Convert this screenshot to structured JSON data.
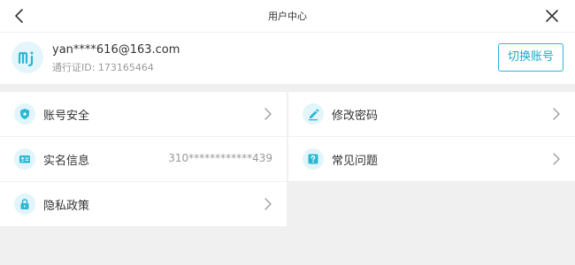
{
  "header": {
    "title": "用户中心",
    "back_icon": "chevron-left-icon",
    "close_icon": "close-icon"
  },
  "profile": {
    "email": "yan****616@163.com",
    "passport_id": "通行证ID: 173165464",
    "switch_label": "切换账号",
    "avatar_icon": "mi-logo-icon"
  },
  "menu": {
    "account_security": {
      "label": "账号安全",
      "icon": "shield-icon"
    },
    "change_password": {
      "label": "修改密码",
      "icon": "pencil-icon"
    },
    "real_name": {
      "label": "实名信息",
      "value": "310************439",
      "icon": "id-card-icon"
    },
    "faq": {
      "label": "常见问题",
      "icon": "question-icon"
    },
    "privacy": {
      "label": "隐私政策",
      "icon": "lock-icon"
    }
  },
  "colors": {
    "accent": "#2bb8d6",
    "icon_bg": "#e1f5fa",
    "background": "#f0f0f0"
  }
}
